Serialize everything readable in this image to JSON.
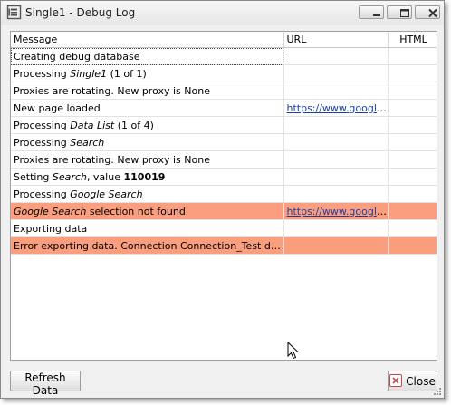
{
  "window": {
    "title": "Single1 - Debug Log"
  },
  "columns": {
    "message": "Message",
    "url": "URL",
    "html": "HTML"
  },
  "rows": [
    {
      "parts": [
        {
          "t": "Creating debug database"
        }
      ],
      "url": "",
      "html": "",
      "status": "normal",
      "focused": true
    },
    {
      "parts": [
        {
          "t": "Processing "
        },
        {
          "t": "Single1",
          "s": "i"
        },
        {
          "t": " (1 of 1)"
        }
      ],
      "url": "",
      "html": "",
      "status": "normal"
    },
    {
      "parts": [
        {
          "t": "Proxies are rotating. New proxy is None"
        }
      ],
      "url": "",
      "html": "",
      "status": "normal"
    },
    {
      "parts": [
        {
          "t": "New page loaded"
        }
      ],
      "url": "https://www.google...",
      "html": "",
      "status": "normal"
    },
    {
      "parts": [
        {
          "t": "Processing "
        },
        {
          "t": "Data List",
          "s": "i"
        },
        {
          "t": " (1 of 4)"
        }
      ],
      "url": "",
      "html": "",
      "status": "normal"
    },
    {
      "parts": [
        {
          "t": "Processing "
        },
        {
          "t": "Search",
          "s": "i"
        }
      ],
      "url": "",
      "html": "",
      "status": "normal"
    },
    {
      "parts": [
        {
          "t": "Proxies are rotating. New proxy is None"
        }
      ],
      "url": "",
      "html": "",
      "status": "normal"
    },
    {
      "parts": [
        {
          "t": "Setting "
        },
        {
          "t": "Search",
          "s": "i"
        },
        {
          "t": ", value "
        },
        {
          "t": "110019",
          "s": "b"
        }
      ],
      "url": "",
      "html": "",
      "status": "normal"
    },
    {
      "parts": [
        {
          "t": "Processing "
        },
        {
          "t": "Google Search",
          "s": "i"
        }
      ],
      "url": "",
      "html": "",
      "status": "normal"
    },
    {
      "parts": [
        {
          "t": "Google Search",
          "s": "i"
        },
        {
          "t": " selection not found"
        }
      ],
      "url": "https://www.google...",
      "html": "",
      "status": "error"
    },
    {
      "parts": [
        {
          "t": "Exporting data"
        }
      ],
      "url": "",
      "html": "",
      "status": "normal"
    },
    {
      "parts": [
        {
          "t": "Error exporting data. Connection Connection_Test does no..."
        }
      ],
      "url": "",
      "html": "",
      "status": "error"
    }
  ],
  "buttons": {
    "refresh": "Refresh Data",
    "close": "Close"
  },
  "colors": {
    "error_row": "#fa9e7e",
    "link": "#1a3fa8",
    "close_icon": "#c24a4a"
  },
  "icons": [
    "app-log-icon",
    "minimize-icon",
    "maximize-icon",
    "close-window-icon",
    "close-icon",
    "mouse-cursor-icon",
    "resize-grip-icon"
  ]
}
